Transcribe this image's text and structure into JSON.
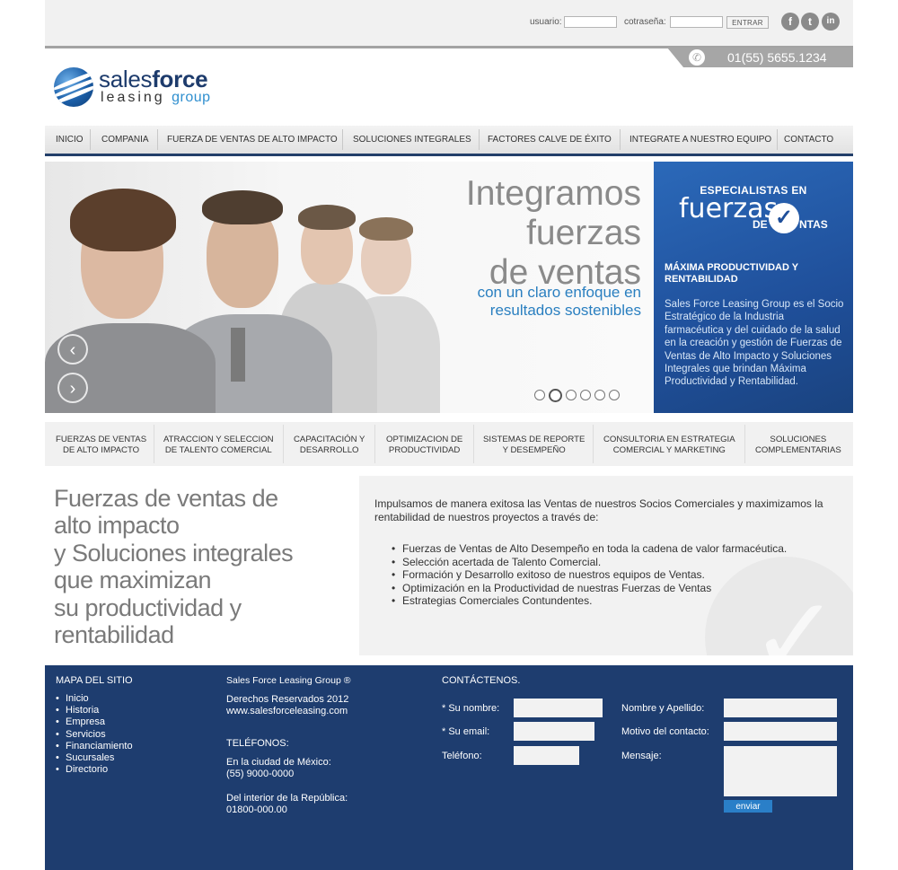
{
  "login": {
    "user_label": "usuario:",
    "pass_label": "cotraseña:",
    "submit_label": "ENTRAR",
    "social": [
      "f",
      "t",
      "in"
    ]
  },
  "header": {
    "phone": "01(55) 5655.1234",
    "logo_part1": "sales",
    "logo_part2": "force",
    "logo_part3": "leasing",
    "logo_part4": "group"
  },
  "nav": [
    "INICIO",
    "COMPANIA",
    "FUERZA DE VENTAS DE ALTO IMPACTO",
    "SOLUCIONES INTEGRALES",
    "FACTORES CALVE DE ÉXITO",
    "INTEGRATE A NUESTRO EQUIPO",
    "CONTACTO"
  ],
  "hero": {
    "line1": "Integramos",
    "line2": "fuerzas",
    "line3": "de ventas",
    "sub1": "con un claro enfoque en",
    "sub2": "resultados sostenibles",
    "slides": 6,
    "active_slide": 2
  },
  "side": {
    "heading1": "ESPECIALISTAS EN",
    "heading2": "fuerzas",
    "heading3": "DE",
    "heading4": "NTAS",
    "subtitle": "MÁXIMA PRODUCTIVIDAD Y RENTABILIDAD",
    "body": "Sales Force Leasing Group es el Socio Estratégico de la Industria farmacéutica y del cuidado de la salud en la creación y gestión de Fuerzas de Ventas de Alto Impacto y Soluciones Integrales que brindan Máxima Productividad y Rentabilidad."
  },
  "services": [
    [
      "FUERZAS DE VENTAS",
      "DE ALTO IMPACTO"
    ],
    [
      "ATRACCION Y SELECCION",
      "DE TALENTO COMERCIAL"
    ],
    [
      "CAPACITACIÓN Y",
      "DESARROLLO"
    ],
    [
      "OPTIMIZACION DE",
      "PRODUCTIVIDAD"
    ],
    [
      "SISTEMAS DE REPORTE",
      "Y DESEMPEÑO"
    ],
    [
      "CONSULTORIA EN ESTRATEGIA",
      "COMERCIAL Y MARKETING"
    ],
    [
      "SOLUCIONES",
      "COMPLEMENTARIAS"
    ]
  ],
  "main": {
    "heading": [
      "Fuerzas de ventas de",
      "alto impacto",
      "y Soluciones integrales",
      "que maximizan",
      "su productividad y",
      "rentabilidad"
    ],
    "intro": "Impulsamos de manera exitosa las Ventas de nuestros Socios Comerciales y maximizamos la rentabilidad de nuestros proyectos a través de:",
    "bullets": [
      "Fuerzas de Ventas de Alto Desempeño en toda la cadena de valor farmacéutica.",
      "Selección acertada de Talento Comercial.",
      "Formación y Desarrollo exitoso de nuestros equipos de Ventas.",
      "Optimización en la Productividad de nuestras Fuerzas de Ventas",
      "Estrategias Comerciales Contundentes."
    ]
  },
  "footer": {
    "sitemap_title": "MAPA DEL SITIO",
    "sitemap": [
      "Inicio",
      "Historia",
      "Empresa",
      "Servicios",
      "Financiamiento",
      "Sucursales",
      "Directorio"
    ],
    "company": "Sales Force Leasing Group ®",
    "rights": "Derechos Reservados 2012",
    "website": "www.salesforceleasing.com",
    "phones_title": "TELÉFONOS:",
    "phone1_label": "En la ciudad de México:",
    "phone1": "(55) 9000-0000",
    "phone2_label": "Del interior de la República:",
    "phone2": "01800-000.00",
    "contact_title": "CONTÁCTENOS.",
    "name_label": "* Su nombre:",
    "email_label": "* Su email:",
    "tel_label": "Teléfono:",
    "fullname_label": "Nombre y Apellido:",
    "reason_label": "Motivo del contacto:",
    "message_label": "Mensaje:",
    "send_label": "enviar"
  }
}
